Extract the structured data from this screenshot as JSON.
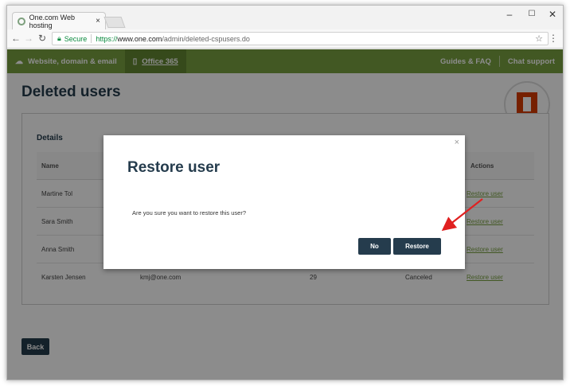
{
  "browser": {
    "tab_title": "One.com Web hosting",
    "tab_close": "×",
    "secure_label": "Secure",
    "url_scheme": "https://",
    "url_host": "www.one.com",
    "url_path": "/admin/deleted-cspusers.do",
    "minimize": "–",
    "maximize": "☐",
    "close": "✕"
  },
  "nav": {
    "item1": "Website, domain & email",
    "item2": "Office 365",
    "guides": "Guides & FAQ",
    "chat": "Chat support"
  },
  "page": {
    "title": "Deleted users",
    "details_title": "Details",
    "back_label": "Back"
  },
  "table": {
    "headers": {
      "name": "Name",
      "actions": "Actions"
    },
    "rows": [
      {
        "name": "Martine Tol",
        "email": "",
        "count": "",
        "status": "",
        "action": "Restore user"
      },
      {
        "name": "Sara Smith",
        "email": "",
        "count": "",
        "status": "",
        "action": "Restore user"
      },
      {
        "name": "Anna Smith",
        "email": "",
        "count": "",
        "status": "",
        "action": "Restore user"
      },
      {
        "name": "Karsten Jensen",
        "email": "kmj@one.com",
        "count": "29",
        "status": "Canceled",
        "action": "Restore user"
      }
    ]
  },
  "modal": {
    "title": "Restore user",
    "message": "Are you sure you want to restore this user?",
    "no_label": "No",
    "restore_label": "Restore",
    "close": "×"
  },
  "colors": {
    "brand_green": "#78a040",
    "navy": "#253c4d",
    "office_orange": "#d83b01",
    "annotation_red": "#e02020"
  }
}
